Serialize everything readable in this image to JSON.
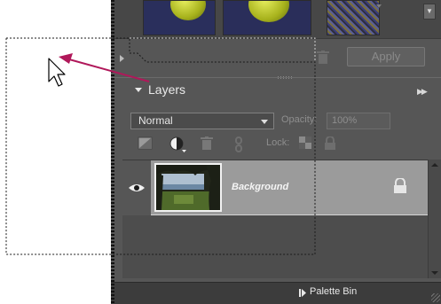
{
  "filter_panel": {
    "apply_label": "Apply"
  },
  "layers_panel": {
    "title": "Layers",
    "blend_mode": "Normal",
    "opacity_label": "Opacity:",
    "opacity_value": "100%",
    "lock_label": "Lock:",
    "layers": [
      {
        "name": "Background",
        "visible": true,
        "locked": true
      }
    ]
  },
  "bottom_bar": {
    "palette_bin_label": "Palette Bin"
  },
  "icons": [
    "eye-icon",
    "new-layer-icon",
    "adjustment-layer-icon",
    "trash-icon",
    "link-icon",
    "lock-transparency-icon",
    "lock-all-icon",
    "palette-bin-icon",
    "panel-menu-icon",
    "collapse-triangle-icon",
    "pointer-cursor-icon",
    "drag-arrow-icon"
  ],
  "colors": {
    "panel_bg": "#565656",
    "selected_layer": "#9b9b9b",
    "drag_arrow": "#b0185a"
  }
}
